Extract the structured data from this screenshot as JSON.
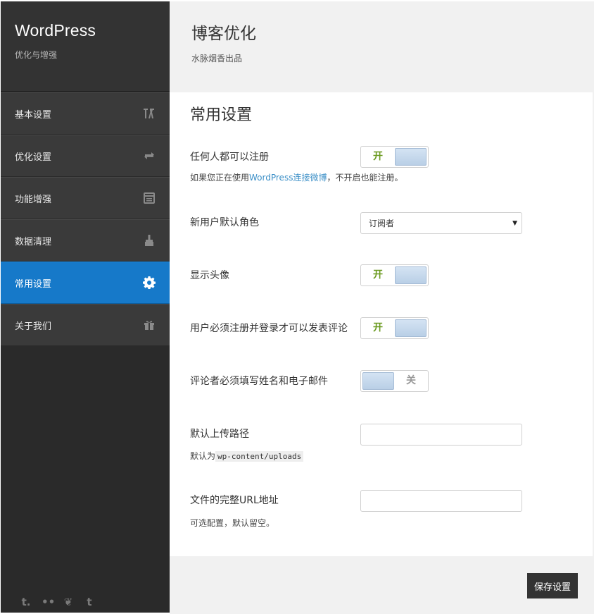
{
  "sidebar": {
    "brand_title": "WordPress",
    "brand_subtitle": "优化与增强",
    "items": [
      {
        "label": "基本设置",
        "icon": "tools-icon",
        "active": false
      },
      {
        "label": "优化设置",
        "icon": "refresh-icon",
        "active": false
      },
      {
        "label": "功能增强",
        "icon": "list-icon",
        "active": false
      },
      {
        "label": "数据清理",
        "icon": "broom-icon",
        "active": false
      },
      {
        "label": "常用设置",
        "icon": "gear-icon",
        "active": true
      },
      {
        "label": "关于我们",
        "icon": "gift-icon",
        "active": false
      }
    ],
    "social": [
      {
        "icon": "tumblr-icon",
        "glyph": "t."
      },
      {
        "icon": "flickr-icon",
        "glyph": "••"
      },
      {
        "icon": "leaf-icon",
        "glyph": "❦"
      },
      {
        "icon": "twitter-icon",
        "glyph": "t"
      }
    ]
  },
  "header": {
    "title": "博客优化",
    "subtitle": "水脉烟香出品"
  },
  "main": {
    "section_title": "常用设置",
    "fields": {
      "anyone_register": {
        "label": "任何人都可以注册",
        "state": "开",
        "help_prefix": "如果您正在使用",
        "help_link": "WordPress连接微博",
        "help_suffix": "，不开启也能注册。"
      },
      "default_role": {
        "label": "新用户默认角色",
        "value": "订阅者"
      },
      "show_avatar": {
        "label": "显示头像",
        "state": "开"
      },
      "require_login": {
        "label": "用户必须注册并登录才可以发表评论",
        "state": "开"
      },
      "require_name_email": {
        "label": "评论者必须填写姓名和电子邮件",
        "state": "关"
      },
      "upload_path": {
        "label": "默认上传路径",
        "help_prefix": "默认为",
        "help_code": "wp-content/uploads",
        "value": ""
      },
      "upload_url": {
        "label": "文件的完整URL地址",
        "help": "可选配置，默认留空。",
        "value": ""
      }
    }
  },
  "footer": {
    "save_label": "保存设置"
  },
  "colors": {
    "accent": "#1679c9",
    "sidebar_bg": "#2a2a2a",
    "on_text": "#6a9a1f"
  }
}
